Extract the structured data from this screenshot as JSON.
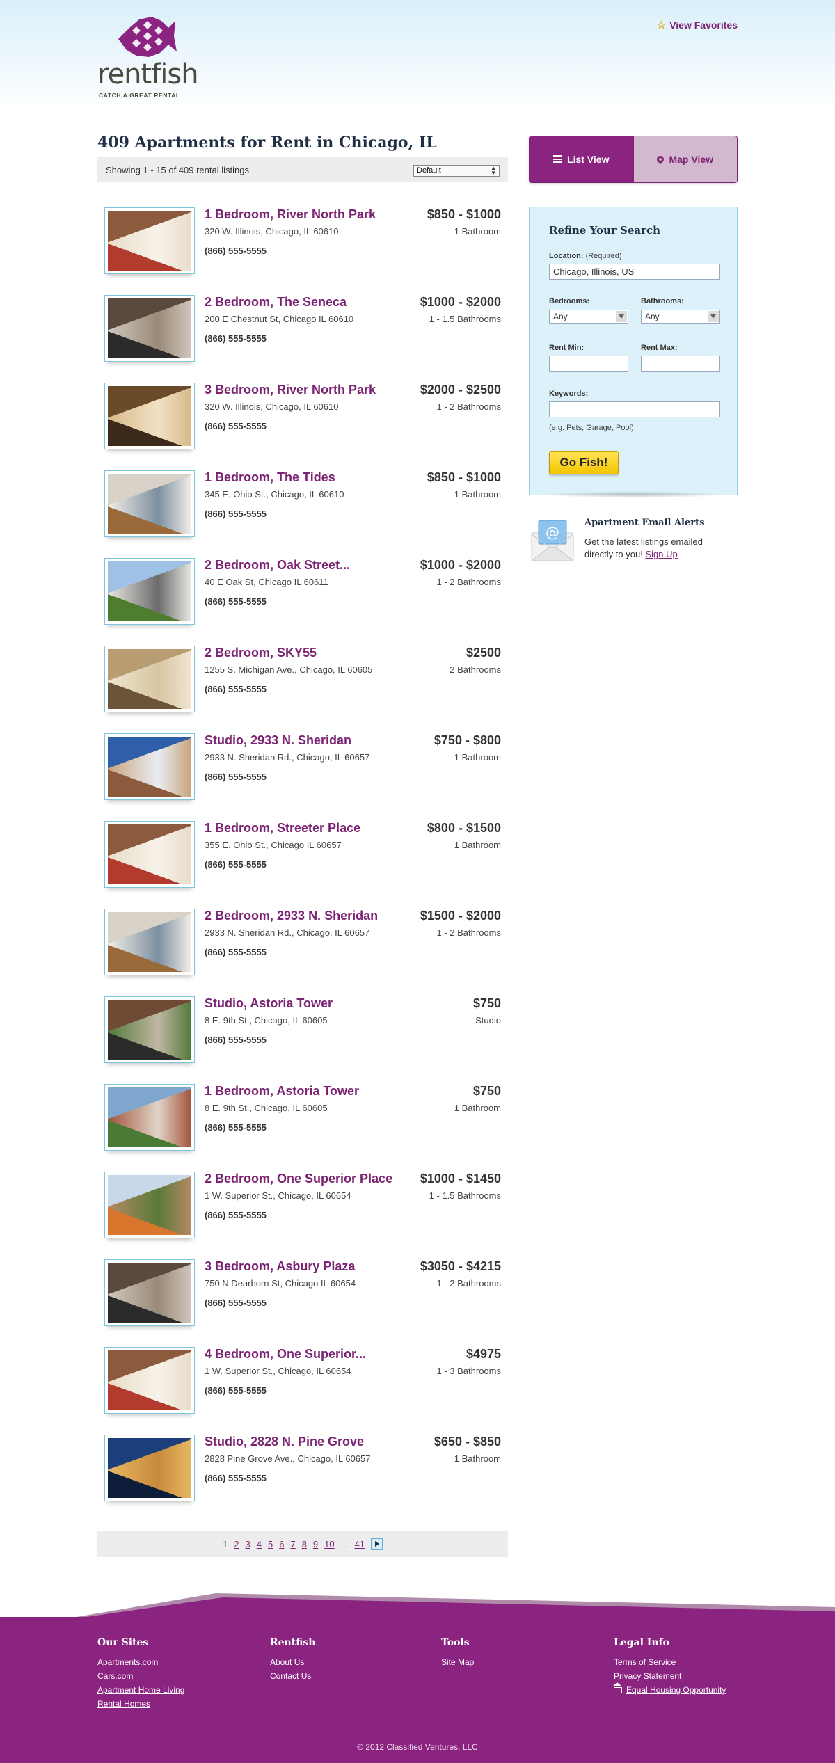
{
  "brand": {
    "name": "rentfish",
    "tagline": "CATCH A GREAT RENTAL",
    "colors": {
      "primary": "#8a2480",
      "link": "#7b2272",
      "accent_yellow": "#f5c400",
      "light_blue": "#dcf1fa"
    }
  },
  "header": {
    "favorites_label": "View Favorites",
    "favorites_icon": "star-icon"
  },
  "results": {
    "title": "409 Apartments for Rent in Chicago, IL",
    "showing": "Showing 1 - 15 of 409 rental listings",
    "sort_selected": "Default"
  },
  "listings": [
    {
      "title": "1 Bedroom, River North Park",
      "address": "320 W. Illinois, Chicago, IL 60610",
      "phone": "(866) 555-5555",
      "price": "$850 - $1000",
      "baths": "1 Bathroom",
      "photo": "bedroom-photo"
    },
    {
      "title": "2 Bedroom, The Seneca",
      "address": "200 E Chestnut St, Chicago IL 60610",
      "phone": "(866) 555-5555",
      "price": "$1000 - $2000",
      "baths": "1 - 1.5 Bathrooms",
      "photo": "kitchen-photo"
    },
    {
      "title": "3 Bedroom, River North Park",
      "address": "320 W. Illinois, Chicago, IL 60610",
      "phone": "(866) 555-5555",
      "price": "$2000 - $2500",
      "baths": "1 - 2 Bathrooms",
      "photo": "living-room-photo"
    },
    {
      "title": "1 Bedroom, The Tides",
      "address": "345 E. Ohio St., Chicago, IL 60610",
      "phone": "(866) 555-5555",
      "price": "$850 - $1000",
      "baths": "1 Bathroom",
      "photo": "empty-room-photo"
    },
    {
      "title": "2 Bedroom, Oak Street...",
      "address": "40 E Oak St, Chicago IL 60611",
      "phone": "(866) 555-5555",
      "price": "$1000 - $2000",
      "baths": "1 - 2 Bathrooms",
      "photo": "building-exterior-photo"
    },
    {
      "title": "2 Bedroom, SKY55",
      "address": "1255 S. Michigan Ave., Chicago, IL 60605",
      "phone": "(866) 555-5555",
      "price": "$2500",
      "baths": "2 Bathrooms",
      "photo": "lounge-photo"
    },
    {
      "title": "Studio, 2933 N. Sheridan",
      "address": "2933 N. Sheridan Rd., Chicago, IL 60657",
      "phone": "(866) 555-5555",
      "price": "$750 - $800",
      "baths": "1 Bathroom",
      "photo": "tower-photo"
    },
    {
      "title": "1 Bedroom, Streeter Place",
      "address": "355 E. Ohio St., Chicago IL 60657",
      "phone": "(866) 555-5555",
      "price": "$800 - $1500",
      "baths": "1 Bathroom",
      "photo": "bedroom-photo"
    },
    {
      "title": "2 Bedroom, 2933 N. Sheridan",
      "address": "2933 N. Sheridan Rd., Chicago, IL 60657",
      "phone": "(866) 555-5555",
      "price": "$1500 - $2000",
      "baths": "1 - 2 Bathrooms",
      "photo": "empty-room-photo"
    },
    {
      "title": "Studio, Astoria Tower",
      "address": "8 E. 9th St., Chicago, IL 60605",
      "phone": "(866) 555-5555",
      "price": "$750",
      "baths": "Studio",
      "photo": "garden-photo"
    },
    {
      "title": "1 Bedroom, Astoria Tower",
      "address": "8 E. 9th St., Chicago, IL 60605",
      "phone": "(866) 555-5555",
      "price": "$750",
      "baths": "1 Bathroom",
      "photo": "brick-building-photo"
    },
    {
      "title": "2 Bedroom, One Superior Place",
      "address": "1 W. Superior St., Chicago, IL 60654",
      "phone": "(866) 555-5555",
      "price": "$1000 - $1450",
      "baths": "1 - 1.5 Bathrooms",
      "photo": "highrise-photo"
    },
    {
      "title": "3 Bedroom, Asbury Plaza",
      "address": "750 N Dearborn St, Chicago IL 60654",
      "phone": "(866) 555-5555",
      "price": "$3050 - $4215",
      "baths": "1 - 2 Bathrooms",
      "photo": "kitchen-photo"
    },
    {
      "title": "4 Bedroom, One Superior...",
      "address": "1 W. Superior St., Chicago, IL 60654",
      "phone": "(866) 555-5555",
      "price": "$4975",
      "baths": "1 - 3 Bathrooms",
      "photo": "bedroom-photo"
    },
    {
      "title": "Studio, 2828 N. Pine Grove",
      "address": "2828 Pine Grove Ave., Chicago, IL 60657",
      "phone": "(866) 555-5555",
      "price": "$650 - $850",
      "baths": "1 Bathroom",
      "photo": "night-tower-photo"
    }
  ],
  "pagination": {
    "current": "1",
    "pages": [
      "2",
      "3",
      "4",
      "5",
      "6",
      "7",
      "8",
      "9",
      "10"
    ],
    "ellipsis": "...",
    "last": "41",
    "next_icon": "arrow-right-icon"
  },
  "view_toggle": {
    "list_label": "List View",
    "map_label": "Map View",
    "active": "list"
  },
  "refine": {
    "title": "Refine Your Search",
    "location_label": "Location:",
    "location_required": "(Required)",
    "location_value": "Chicago, Illinois, US",
    "bedrooms_label": "Bedrooms:",
    "bedrooms_value": "Any",
    "bathrooms_label": "Bathrooms:",
    "bathrooms_value": "Any",
    "rent_min_label": "Rent Min:",
    "rent_max_label": "Rent Max:",
    "rent_separator": "-",
    "keywords_label": "Keywords:",
    "keywords_hint": "(e.g. Pets, Garage, Pool)",
    "submit_label": "Go Fish!"
  },
  "alerts": {
    "title": "Apartment Email Alerts",
    "text": "Get the latest listings emailed directly to you!",
    "signup_label": "Sign Up"
  },
  "footer": {
    "columns": [
      {
        "heading": "Our Sites",
        "links": [
          "Apartments.com",
          "Cars.com",
          "Apartment Home Living",
          "Rental Homes"
        ]
      },
      {
        "heading": "Rentfish",
        "links": [
          "About Us",
          "Contact Us"
        ]
      },
      {
        "heading": "Tools",
        "links": [
          "Site Map"
        ]
      },
      {
        "heading": "Legal Info",
        "links": [
          "Terms of Service",
          "Privacy Statement",
          "Equal Housing Opportunity"
        ]
      }
    ],
    "copyright": "© 2012 Classified Ventures, LLC"
  }
}
